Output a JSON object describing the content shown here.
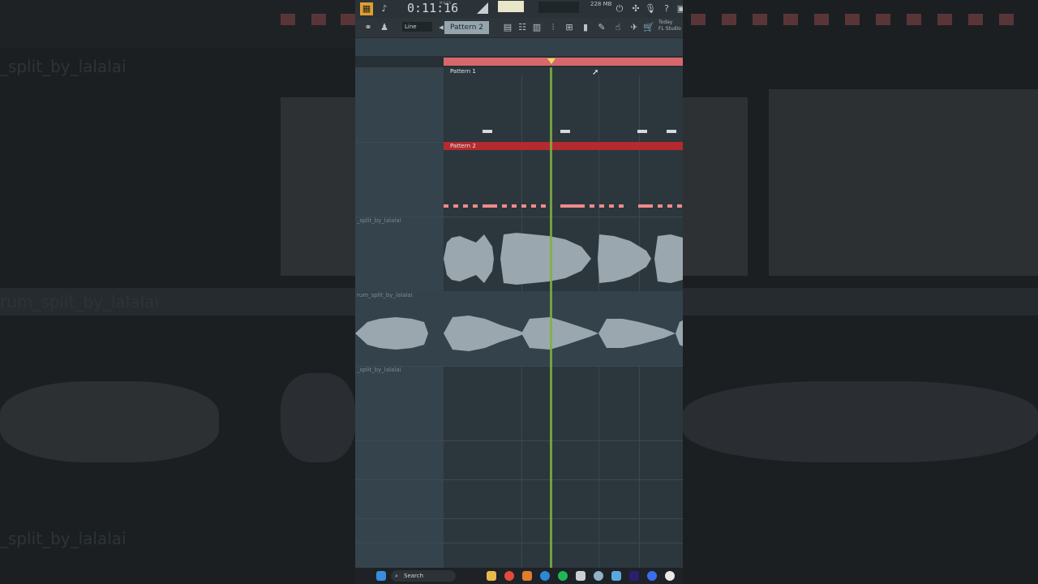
{
  "background": {
    "labels": [
      "_split_by_lalalai",
      "rum_split_by_lalalai",
      "_split_by_lalalai"
    ]
  },
  "toolbar": {
    "time_display": "0:11:16",
    "time_unit": "M:S:CS",
    "memory": "228 MB",
    "line_mode": "Line",
    "pattern_selector": "Pattern 2",
    "hint_line1": "Today",
    "hint_line2": "FL Studio"
  },
  "playlist": {
    "clips": [
      {
        "title": "Pattern 1"
      },
      {
        "title": "Pattern 2"
      }
    ],
    "audio_tracks": [
      {
        "label": "_split_by_lalalai"
      },
      {
        "label": "rum_split_by_lalalai"
      },
      {
        "label": "_split_by_lalalai"
      }
    ]
  },
  "taskbar": {
    "search_label": "Search",
    "apps": [
      "windows-start-icon",
      "file-explorer-icon",
      "chrome-icon",
      "fl-studio-icon",
      "edge-icon",
      "spotify-icon",
      "calculator-icon",
      "settings-icon",
      "notepad-icon",
      "premiere-icon",
      "messenger-icon",
      "steam-icon"
    ]
  },
  "colors": {
    "pattern_bar": "#d8676c",
    "pattern2_header": "#b52a2f",
    "playhead": "#7cb342",
    "note_red": "#f08a8a"
  }
}
